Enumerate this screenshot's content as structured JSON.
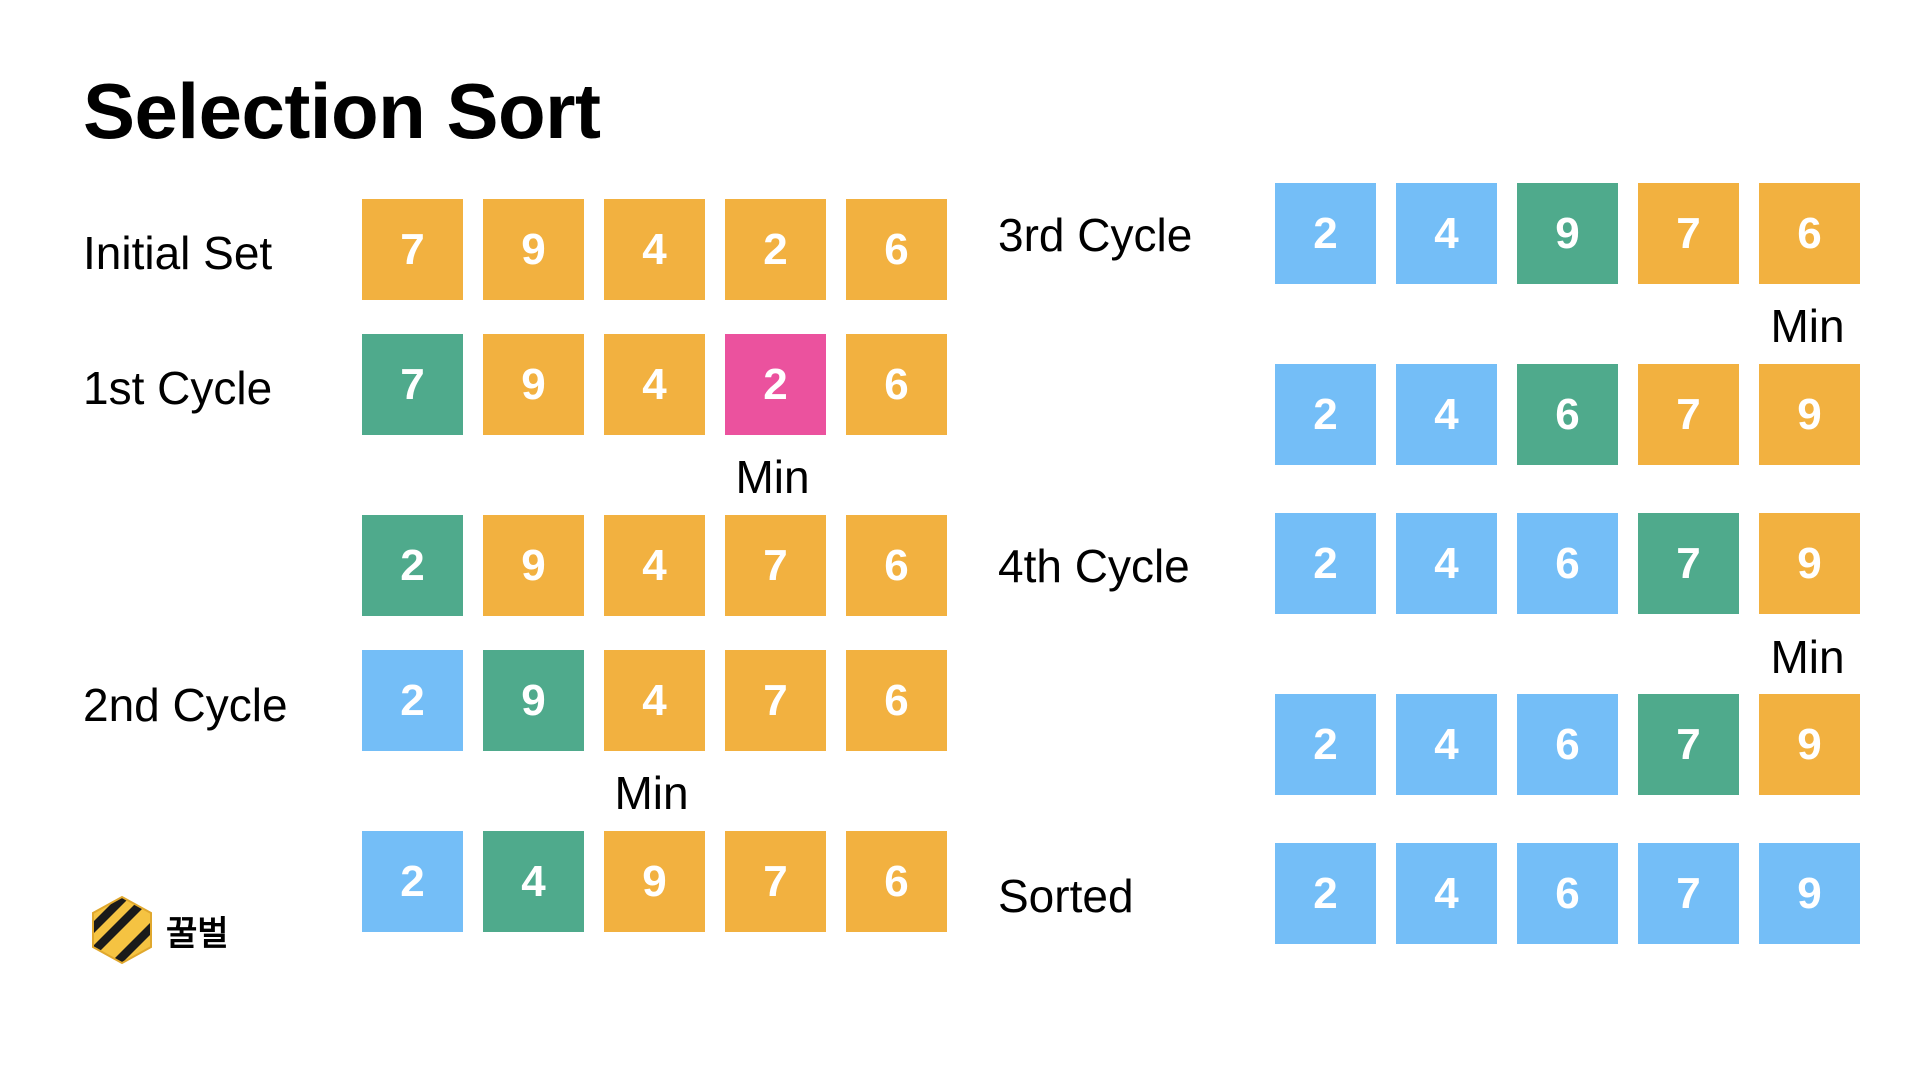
{
  "title": "Selection Sort",
  "colors": {
    "orange": "#F2B140",
    "green": "#4FAA8C",
    "pink": "#EB529E",
    "blue": "#74BEF7"
  },
  "labels": {
    "initial": "Initial Set",
    "cycle1": "1st Cycle",
    "cycle2": "2nd Cycle",
    "cycle3": "3rd Cycle",
    "cycle4": "4th Cycle",
    "sorted": "Sorted"
  },
  "min_label": "Min",
  "rows": {
    "initial": [
      {
        "value": "7",
        "color": "orange"
      },
      {
        "value": "9",
        "color": "orange"
      },
      {
        "value": "4",
        "color": "orange"
      },
      {
        "value": "2",
        "color": "orange"
      },
      {
        "value": "6",
        "color": "orange"
      }
    ],
    "c1a": [
      {
        "value": "7",
        "color": "green"
      },
      {
        "value": "9",
        "color": "orange"
      },
      {
        "value": "4",
        "color": "orange"
      },
      {
        "value": "2",
        "color": "pink"
      },
      {
        "value": "6",
        "color": "orange"
      }
    ],
    "c1b": [
      {
        "value": "2",
        "color": "green"
      },
      {
        "value": "9",
        "color": "orange"
      },
      {
        "value": "4",
        "color": "orange"
      },
      {
        "value": "7",
        "color": "orange"
      },
      {
        "value": "6",
        "color": "orange"
      }
    ],
    "c2a": [
      {
        "value": "2",
        "color": "blue"
      },
      {
        "value": "9",
        "color": "green"
      },
      {
        "value": "4",
        "color": "orange"
      },
      {
        "value": "7",
        "color": "orange"
      },
      {
        "value": "6",
        "color": "orange"
      }
    ],
    "c2b": [
      {
        "value": "2",
        "color": "blue"
      },
      {
        "value": "4",
        "color": "green"
      },
      {
        "value": "9",
        "color": "orange"
      },
      {
        "value": "7",
        "color": "orange"
      },
      {
        "value": "6",
        "color": "orange"
      }
    ],
    "c3a": [
      {
        "value": "2",
        "color": "blue"
      },
      {
        "value": "4",
        "color": "blue"
      },
      {
        "value": "9",
        "color": "green"
      },
      {
        "value": "7",
        "color": "orange"
      },
      {
        "value": "6",
        "color": "orange"
      }
    ],
    "c3b": [
      {
        "value": "2",
        "color": "blue"
      },
      {
        "value": "4",
        "color": "blue"
      },
      {
        "value": "6",
        "color": "green"
      },
      {
        "value": "7",
        "color": "orange"
      },
      {
        "value": "9",
        "color": "orange"
      }
    ],
    "c4a": [
      {
        "value": "2",
        "color": "blue"
      },
      {
        "value": "4",
        "color": "blue"
      },
      {
        "value": "6",
        "color": "blue"
      },
      {
        "value": "7",
        "color": "green"
      },
      {
        "value": "9",
        "color": "orange"
      }
    ],
    "c4b": [
      {
        "value": "2",
        "color": "blue"
      },
      {
        "value": "4",
        "color": "blue"
      },
      {
        "value": "6",
        "color": "blue"
      },
      {
        "value": "7",
        "color": "green"
      },
      {
        "value": "9",
        "color": "orange"
      }
    ],
    "sorted": [
      {
        "value": "2",
        "color": "blue"
      },
      {
        "value": "4",
        "color": "blue"
      },
      {
        "value": "6",
        "color": "blue"
      },
      {
        "value": "7",
        "color": "blue"
      },
      {
        "value": "9",
        "color": "blue"
      }
    ]
  },
  "logo": {
    "text": "꿀벌",
    "icon": "honeycomb-logo-icon"
  }
}
